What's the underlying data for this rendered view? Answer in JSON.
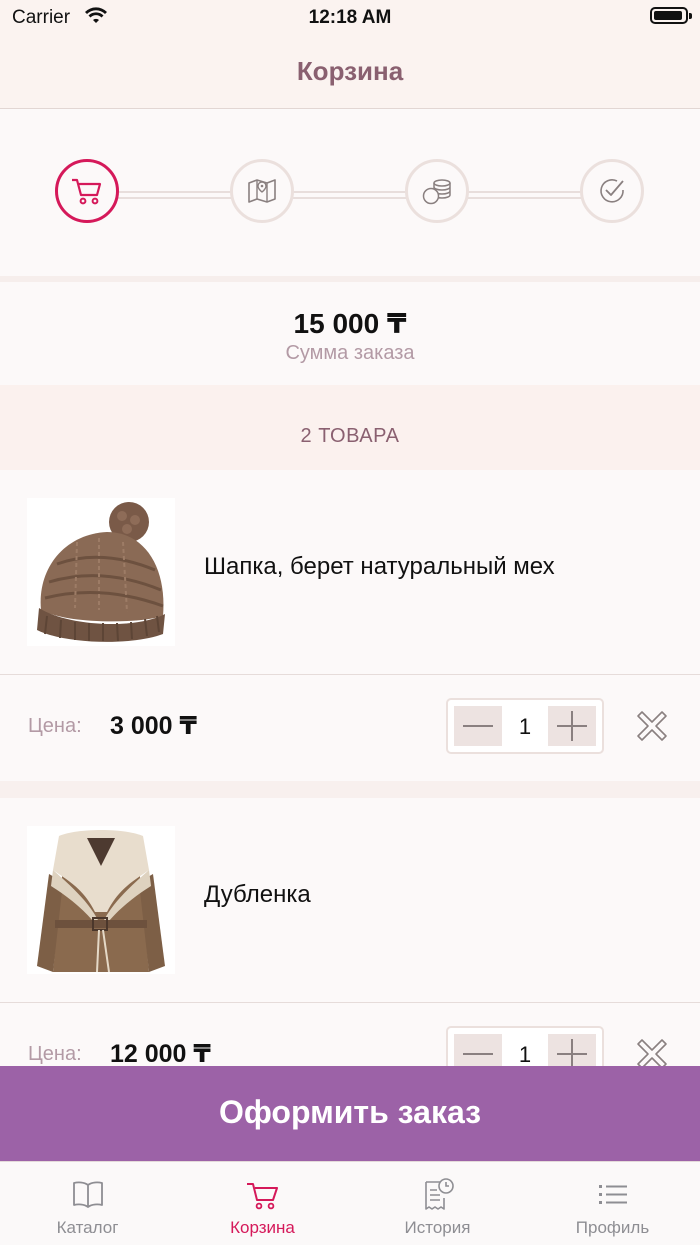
{
  "status_bar": {
    "carrier": "Carrier",
    "time": "12:18 AM"
  },
  "nav": {
    "title": "Корзина"
  },
  "steps": [
    {
      "icon": "cart-icon",
      "active": true
    },
    {
      "icon": "map-icon",
      "active": false
    },
    {
      "icon": "coins-icon",
      "active": false
    },
    {
      "icon": "check-circle-icon",
      "active": false
    }
  ],
  "order": {
    "total": "15 000 ₸",
    "total_label": "Сумма заказа"
  },
  "items_count": "2 ТОВАРА",
  "items": [
    {
      "name": "Шапка, берет натуральный мех",
      "price_label": "Цена:",
      "price": "3 000 ₸",
      "qty": "1",
      "image": "knit-hat"
    },
    {
      "name": "Дубленка",
      "price_label": "Цена:",
      "price": "12 000 ₸",
      "qty": "1",
      "image": "sheepskin-coat"
    }
  ],
  "checkout": {
    "label": "Оформить заказ"
  },
  "tabs": [
    {
      "label": "Каталог",
      "icon": "book-icon",
      "active": false
    },
    {
      "label": "Корзина",
      "icon": "cart-icon",
      "active": true
    },
    {
      "label": "История",
      "icon": "receipt-clock-icon",
      "active": false
    },
    {
      "label": "Профиль",
      "icon": "list-icon",
      "active": false
    }
  ],
  "colors": {
    "accent": "#d5195a",
    "checkout": "#9c62a7",
    "title": "#8a6070",
    "muted": "#b39aa5"
  }
}
